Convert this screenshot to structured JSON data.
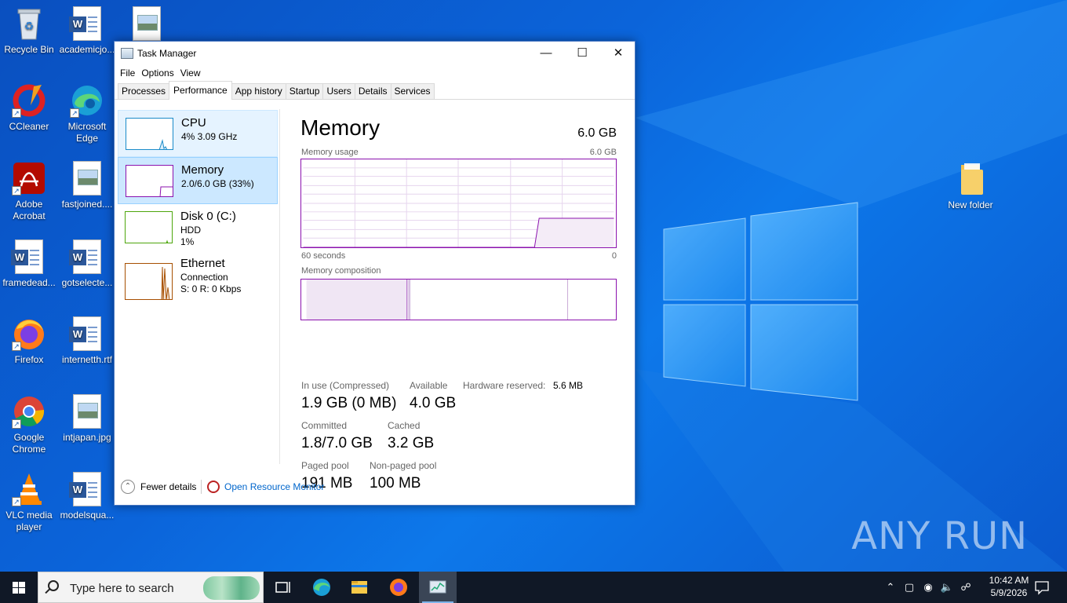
{
  "desktop": {
    "icons": [
      {
        "label": "Recycle Bin",
        "icon": "recycle-bin-icon"
      },
      {
        "label": "academicjo...",
        "icon": "word-document-icon"
      },
      {
        "label": "",
        "icon": "image-file-icon"
      },
      {
        "label": "CCleaner",
        "icon": "ccleaner-icon"
      },
      {
        "label": "Microsoft Edge",
        "icon": "edge-icon"
      },
      {
        "label": "Adobe Acrobat",
        "icon": "acrobat-icon"
      },
      {
        "label": "fastjoined....",
        "icon": "image-file-icon"
      },
      {
        "label": "framedead...",
        "icon": "word-document-icon"
      },
      {
        "label": "gotselecte...",
        "icon": "word-document-icon"
      },
      {
        "label": "Firefox",
        "icon": "firefox-icon"
      },
      {
        "label": "internetth.rtf",
        "icon": "word-document-icon"
      },
      {
        "label": "Google Chrome",
        "icon": "chrome-icon"
      },
      {
        "label": "intjapan.jpg",
        "icon": "image-file-icon"
      },
      {
        "label": "VLC media player",
        "icon": "vlc-icon"
      },
      {
        "label": "modelsqua...",
        "icon": "word-document-icon"
      },
      {
        "label": "New folder",
        "icon": "folder-icon"
      }
    ],
    "watermark": "ANY RUN"
  },
  "taskmanager": {
    "title": "Task Manager",
    "menu": [
      "File",
      "Options",
      "View"
    ],
    "tabs": [
      "Processes",
      "Performance",
      "App history",
      "Startup",
      "Users",
      "Details",
      "Services"
    ],
    "active_tab": "Performance",
    "resources": [
      {
        "name": "CPU",
        "line1": "4%  3.09 GHz",
        "line2": "",
        "color": "#1a8bc9"
      },
      {
        "name": "Memory",
        "line1": "2.0/6.0 GB (33%)",
        "line2": "",
        "color": "#8b12ae"
      },
      {
        "name": "Disk 0 (C:)",
        "line1": "HDD",
        "line2": "1%",
        "color": "#4da60c"
      },
      {
        "name": "Ethernet",
        "line1": "Connection",
        "line2": "S: 0  R: 0 Kbps",
        "color": "#a74f01"
      }
    ],
    "memory": {
      "title": "Memory",
      "capacity": "6.0 GB",
      "usage_label": "Memory usage",
      "usage_max": "6.0 GB",
      "time_label": "60 seconds",
      "time_end": "0",
      "composition_label": "Memory composition",
      "usage_fraction": 0.33,
      "stats": [
        {
          "label": "In use (Compressed)",
          "value": "1.9 GB (0 MB)"
        },
        {
          "label": "Available",
          "value": "4.0 GB"
        },
        {
          "label": "Hardware reserved:",
          "value": "5.6 MB"
        },
        {
          "label": "Committed",
          "value": "1.8/7.0 GB"
        },
        {
          "label": "Cached",
          "value": "3.2 GB"
        },
        {
          "label": "Paged pool",
          "value": "191 MB"
        },
        {
          "label": "Non-paged pool",
          "value": "100 MB"
        }
      ]
    },
    "footer": {
      "fewer": "Fewer details",
      "resmon": "Open Resource Monitor"
    }
  },
  "taskbar": {
    "search_placeholder": "Type here to search",
    "time": "10:42 AM",
    "date": "5/9/2026"
  }
}
